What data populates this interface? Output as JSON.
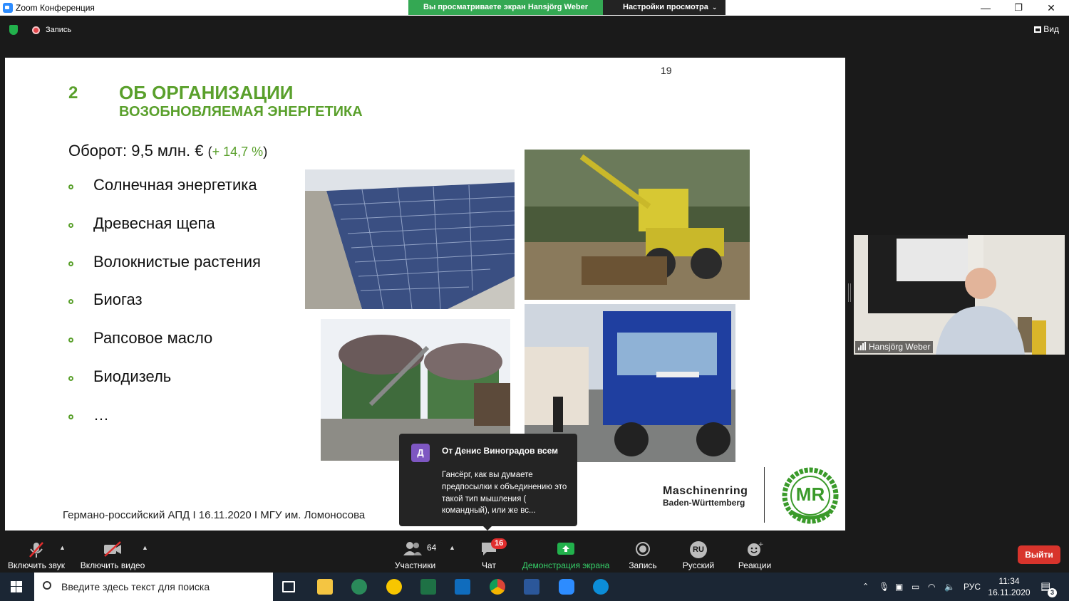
{
  "window": {
    "title": "Zoom Конференция",
    "share_banner": "Вы просматриваете экран Hansjörg Weber",
    "view_settings": "Настройки просмотра",
    "minimize": "—",
    "restore": "❐",
    "close": "✕"
  },
  "topbar": {
    "recording_label": "Запись",
    "view_label": "Вид"
  },
  "slide": {
    "page_number": "19",
    "section_number": "2",
    "title": "ОБ ОРГАНИЗАЦИИ",
    "subtitle": "ВОЗОБНОВЛЯЕМАЯ ЭНЕРГЕТИКА",
    "turnover_label": "Оборот: 9,5 млн. € ",
    "turnover_paren_open": "(",
    "turnover_change": "+ 14,7 %",
    "turnover_paren_close": ")",
    "bullets": [
      "Солнечная энергетика",
      "Древесная щепа",
      "Волокнистые растения",
      "Биогаз",
      "Рапсовое масло",
      "Биодизель",
      "…"
    ],
    "footer": "Германо-российский АПД I 16.11.2020 I МГУ им. Ломоносова",
    "org_name": "Maschinenring",
    "org_sub": "Baden-Württemberg",
    "logo_text": "MR"
  },
  "speaker": {
    "name": "Hansjörg Weber"
  },
  "chat_popup": {
    "avatar": "Д",
    "from": "От Денис Виноградов всем",
    "message": "Гансёрг,  как вы думаете предпосылки к объединению это такой тип мышления ( командный), или же вс..."
  },
  "toolbar": {
    "unmute": "Включить звук",
    "start_video": "Включить видео",
    "participants": "Участники",
    "participants_count": "64",
    "chat": "Чат",
    "chat_badge": "16",
    "share_screen": "Демонстрация экрана",
    "record": "Запись",
    "language": "Русский",
    "language_code": "RU",
    "reactions": "Реакции",
    "leave": "Выйти"
  },
  "taskbar": {
    "search_placeholder": "Введите здесь текст для поиска",
    "lang": "РУС",
    "time": "11:34",
    "date": "16.11.2020",
    "notifications": "3"
  },
  "colors": {
    "brand_green": "#5aa02c",
    "zoom_share_green": "#34A853",
    "leave_red": "#d8342c",
    "zoom_blue": "#2D8CFF"
  }
}
